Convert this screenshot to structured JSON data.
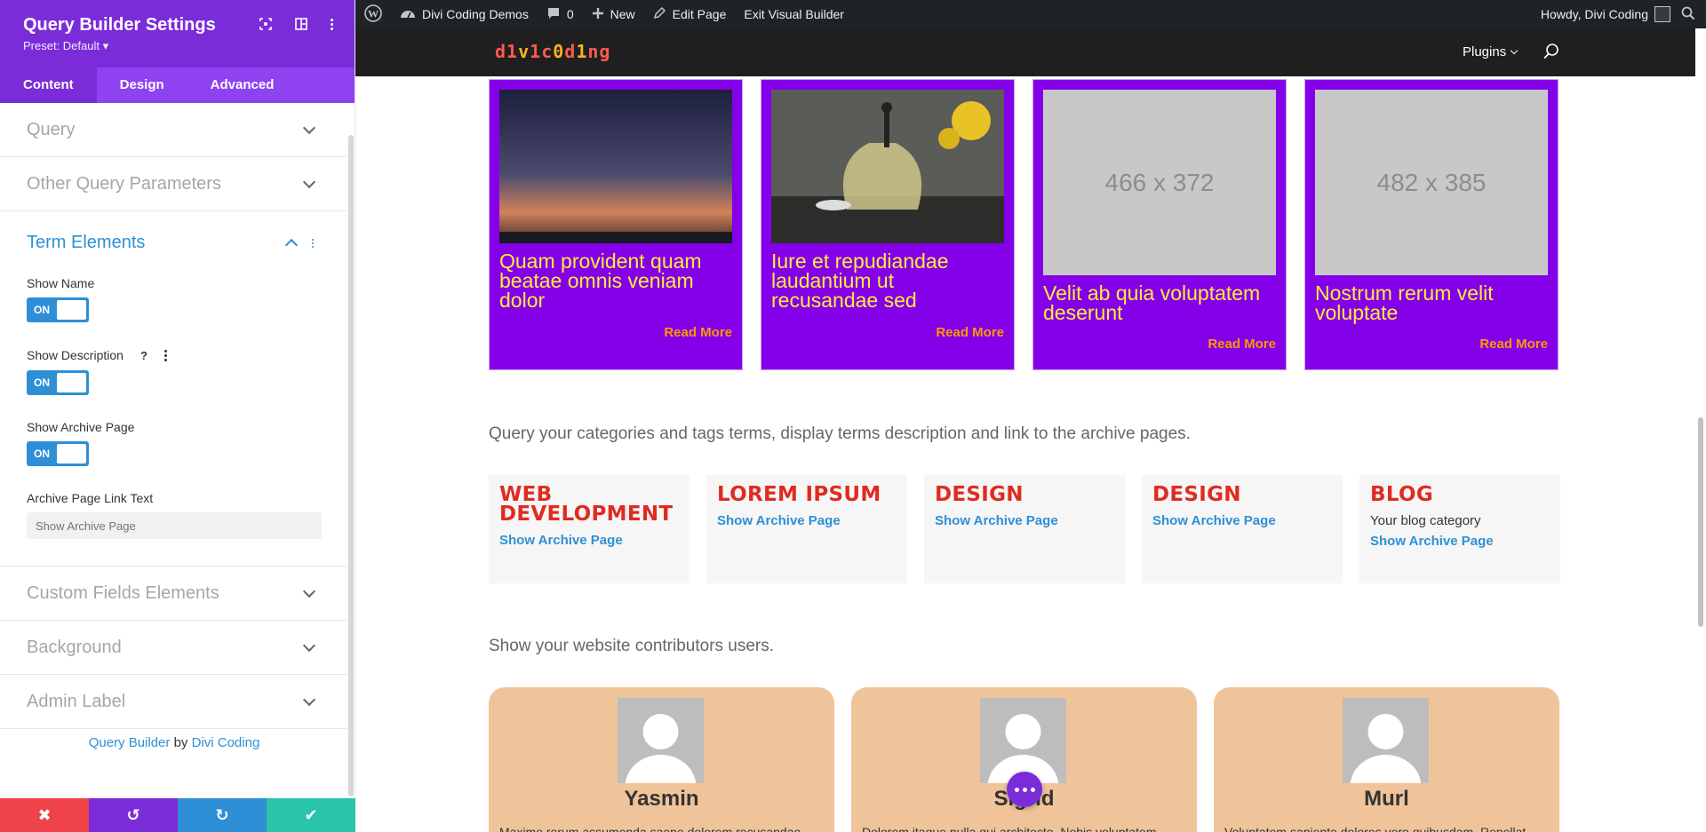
{
  "panel": {
    "title": "Query Builder Settings",
    "preset": "Preset: Default ▾",
    "tabs": [
      {
        "label": "Content",
        "active": true
      },
      {
        "label": "Design",
        "active": false
      },
      {
        "label": "Advanced",
        "active": false
      }
    ],
    "sections_top": [
      "Query",
      "Other Query Parameters"
    ],
    "term_elements": {
      "title": "Term Elements",
      "show_name_label": "Show Name",
      "show_description_label": "Show Description",
      "show_archive_label": "Show Archive Page",
      "toggle_on": "ON",
      "help_glyph": "?",
      "archive_link_label": "Archive Page Link Text",
      "archive_link_placeholder": "Show Archive Page"
    },
    "sections_bottom": [
      "Custom Fields Elements",
      "Background",
      "Admin Label"
    ],
    "footer": {
      "plugin": "Query Builder",
      "by": "by",
      "author": "Divi Coding"
    },
    "actions": {
      "cancel": "✖",
      "undo": "↺",
      "redo": "↻",
      "save": "✔"
    },
    "colors": {
      "cancel": "#ef4349",
      "undo": "#7b2cd9",
      "redo": "#2e8fd6",
      "save": "#29c4a9"
    }
  },
  "adminbar": {
    "site": "Divi Coding Demos",
    "comments": "0",
    "new": "New",
    "edit": "Edit Page",
    "exit": "Exit Visual Builder",
    "howdy": "Howdy, Divi Coding"
  },
  "header": {
    "logo": "d1v1c0d1ng",
    "nav_plugins": "Plugins"
  },
  "posts": [
    {
      "title": "Quam provident quam beatae omnis veniam dolor",
      "read_more": "Read More",
      "image": "sunset"
    },
    {
      "title": "Iure et repudiandae laudantium ut recusandae sed",
      "read_more": "Read More",
      "image": "teapot"
    },
    {
      "title": "Velit ab quia voluptatem deserunt",
      "read_more": "Read More",
      "image": "466 x 372"
    },
    {
      "title": "Nostrum rerum velit voluptate",
      "read_more": "Read More",
      "image": "482 x 385"
    }
  ],
  "terms_text": "Query your categories and tags terms, display terms description and link to the archive pages.",
  "terms": [
    {
      "name": "WEB DEVELOPMENT",
      "desc": "",
      "link": "Show Archive Page"
    },
    {
      "name": "LOREM IPSUM",
      "desc": "",
      "link": "Show Archive Page"
    },
    {
      "name": "DESIGN",
      "desc": "",
      "link": "Show Archive Page"
    },
    {
      "name": "DESIGN",
      "desc": "",
      "link": "Show Archive Page"
    },
    {
      "name": "BLOG",
      "desc": "Your blog category",
      "link": "Show Archive Page"
    }
  ],
  "users_text": "Show your website contributors users.",
  "users": [
    {
      "name": "Yasmin",
      "bio": "Maxime rerum assumenda saepe dolorem recusandae"
    },
    {
      "name": "Sigrid",
      "bio": "Dolorem itaque nulla qui architecto. Nobis voluptatem"
    },
    {
      "name": "Murl",
      "bio": "Voluptatem sapiente dolores vero quibusdam. Repellat"
    }
  ]
}
